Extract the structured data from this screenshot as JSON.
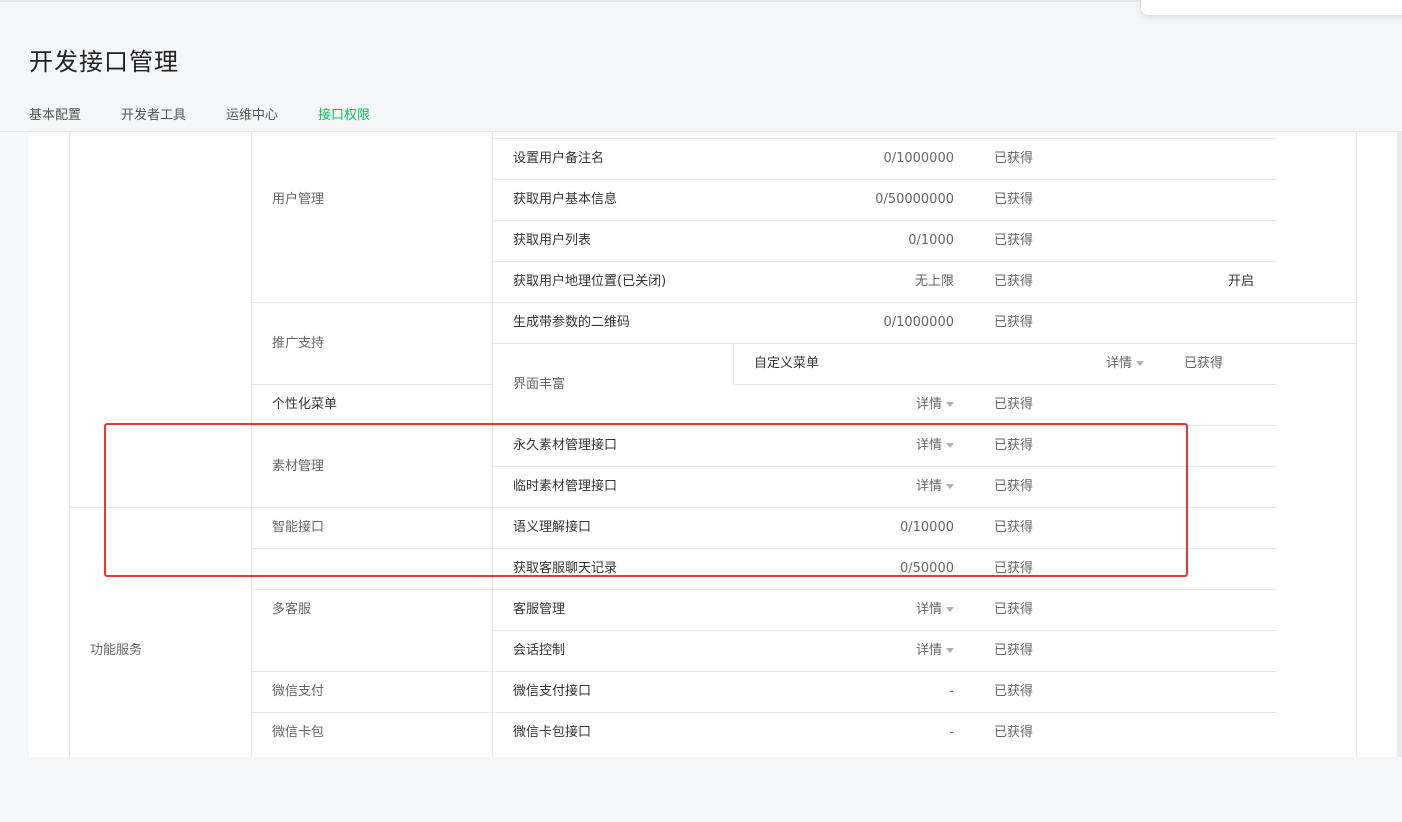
{
  "page": {
    "title": "开发接口管理"
  },
  "tabs": [
    "基本配置",
    "开发者工具",
    "运维中心",
    "接口权限"
  ],
  "categories": {
    "feature_service": "功能服务"
  },
  "groups": {
    "user_mgmt": "用户管理",
    "promotion": "推广支持",
    "ui_rich": "界面丰富",
    "personal_menu": "个性化菜单",
    "material": "素材管理",
    "smart": "智能接口",
    "multi_cs": "多客服",
    "wxpay": "微信支付",
    "wxcard": "微信卡包"
  },
  "rows": [
    {
      "name": "设置用户备注名",
      "quota": "0/1000000",
      "status": "已获得"
    },
    {
      "name": "获取用户基本信息",
      "quota": "0/50000000",
      "status": "已获得"
    },
    {
      "name": "获取用户列表",
      "quota": "0/1000",
      "status": "已获得"
    },
    {
      "name": "获取用户地理位置(已关闭)",
      "quota": "无上限",
      "status": "已获得",
      "action": "开启"
    },
    {
      "name": "生成带参数的二维码",
      "quota": "0/1000000",
      "status": "已获得"
    },
    {
      "name": "自定义菜单",
      "quota": "详情",
      "status": "已获得"
    },
    {
      "name": "",
      "quota": "详情",
      "status": "已获得"
    },
    {
      "name": "永久素材管理接口",
      "quota": "详情",
      "status": "已获得"
    },
    {
      "name": "临时素材管理接口",
      "quota": "详情",
      "status": "已获得"
    },
    {
      "name": "语义理解接口",
      "quota": "0/10000",
      "status": "已获得"
    },
    {
      "name": "获取客服聊天记录",
      "quota": "0/50000",
      "status": "已获得"
    },
    {
      "name": "客服管理",
      "quota": "详情",
      "status": "已获得"
    },
    {
      "name": "会话控制",
      "quota": "详情",
      "status": "已获得"
    },
    {
      "name": "微信支付接口",
      "quota": "-",
      "status": "已获得"
    },
    {
      "name": "微信卡包接口",
      "quota": "-",
      "status": "已获得"
    }
  ],
  "colors": {
    "accent": "#07c160",
    "highlight_box": "#e53935"
  }
}
